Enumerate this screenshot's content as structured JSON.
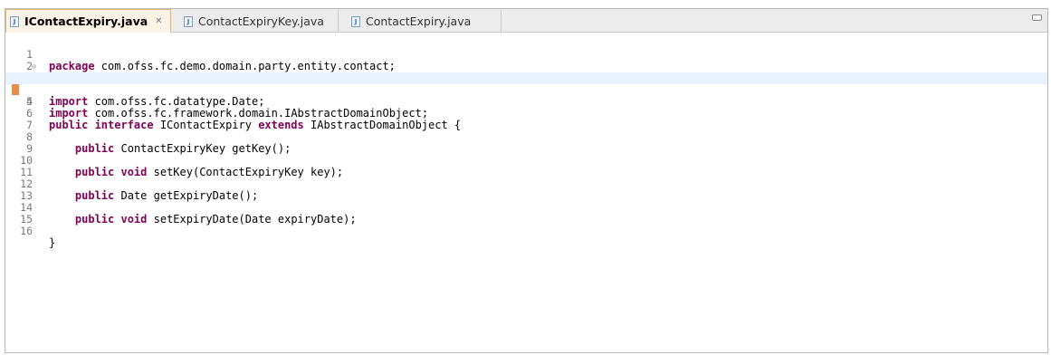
{
  "tabs": [
    {
      "label": "IContactExpiry.java",
      "active": true,
      "close": "✕"
    },
    {
      "label": "ContactExpiryKey.java",
      "active": false
    },
    {
      "label": "ContactExpiry.java",
      "active": false
    }
  ],
  "file_icon": "java-file-icon",
  "colors": {
    "keyword": "#7f0055",
    "active_tab_border": "#e2b672",
    "current_line": "#e8f2fe",
    "marker": "#e9894a"
  },
  "code": {
    "lines": [
      {
        "num": "1",
        "kw": "package",
        "text": " com.ofss.fc.demo.domain.party.entity.contact;"
      },
      {
        "num": "2",
        "kw": "",
        "text": ""
      },
      {
        "num": "3",
        "kw": "import",
        "text": " com.ofss.fc.datatype.Date;"
      },
      {
        "num": "4",
        "kw": "import",
        "text": " com.ofss.fc.framework.domain.IAbstractDomainObject;"
      },
      {
        "num": "5",
        "kw": "",
        "text": ""
      },
      {
        "num": "6",
        "kw": "public interface",
        "text": " IContactExpiry ",
        "kw2": "extends",
        "text2": " IAbstractDomainObject {"
      },
      {
        "num": "7",
        "kw": "",
        "text": ""
      },
      {
        "num": "8",
        "indent": "    ",
        "kw": "public",
        "text": " ContactExpiryKey getKey();"
      },
      {
        "num": "9",
        "kw": "",
        "text": ""
      },
      {
        "num": "10",
        "indent": "    ",
        "kw": "public void",
        "text": " setKey(ContactExpiryKey key);"
      },
      {
        "num": "11",
        "kw": "",
        "text": ""
      },
      {
        "num": "12",
        "indent": "    ",
        "kw": "public",
        "text": " Date getExpiryDate();"
      },
      {
        "num": "13",
        "kw": "",
        "text": ""
      },
      {
        "num": "14",
        "indent": "    ",
        "kw": "public void",
        "text": " setExpiryDate(Date expiryDate);"
      },
      {
        "num": "15",
        "kw": "",
        "text": ""
      },
      {
        "num": "16",
        "kw": "",
        "text": "}"
      }
    ]
  }
}
